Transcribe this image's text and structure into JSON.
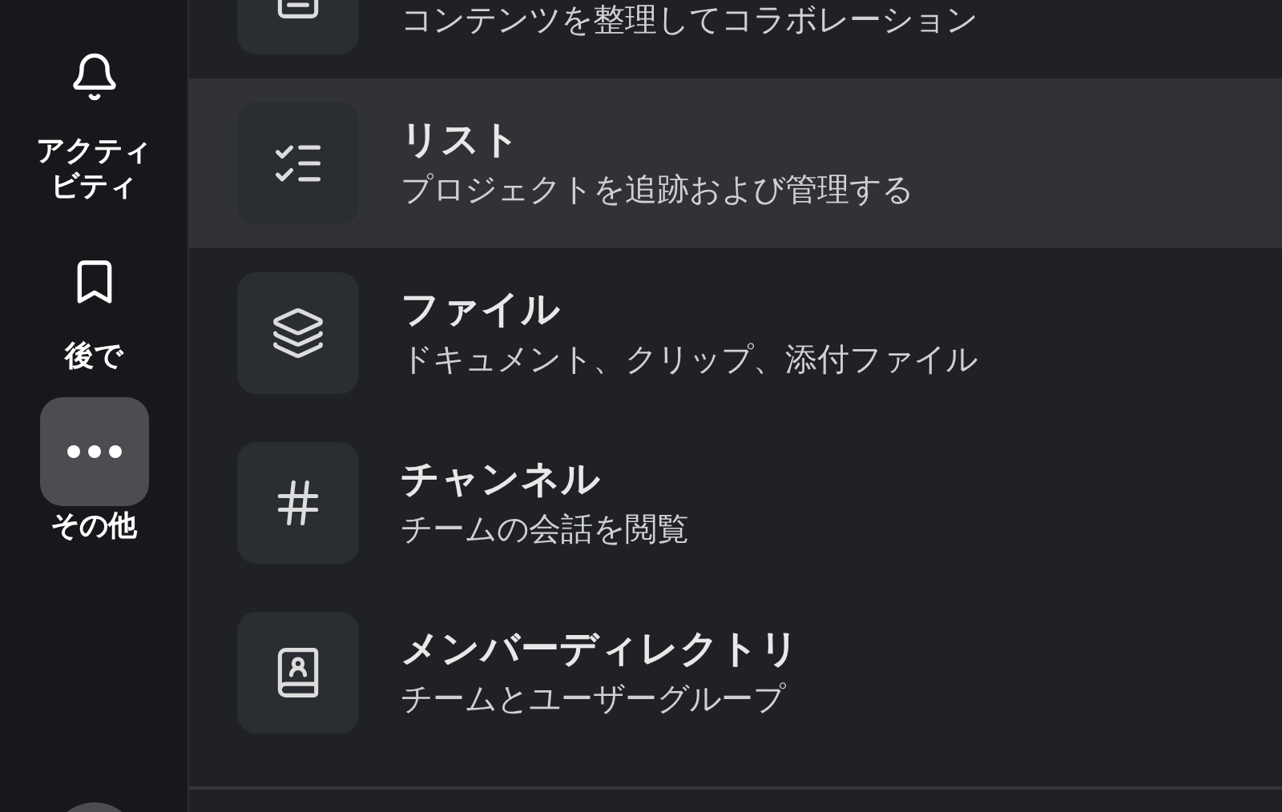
{
  "sidebar": {
    "items": [
      {
        "label": "アクティビティ",
        "selected": false
      },
      {
        "label": "後で",
        "selected": false
      },
      {
        "label": "その他",
        "selected": true
      }
    ]
  },
  "menu": {
    "rows": [
      {
        "subtitle": "コンテンツを整理してコラボレーション",
        "selected": false
      },
      {
        "title": "リスト",
        "subtitle": "プロジェクトを追跡および管理する",
        "selected": true
      },
      {
        "title": "ファイル",
        "subtitle": "ドキュメント、クリップ、添付ファイル",
        "selected": false
      },
      {
        "title": "チャンネル",
        "subtitle": "チームの会話を閲覧",
        "selected": false
      },
      {
        "title": "メンバーディレクトリ",
        "subtitle": "チームとユーザーグループ",
        "selected": false
      }
    ]
  }
}
